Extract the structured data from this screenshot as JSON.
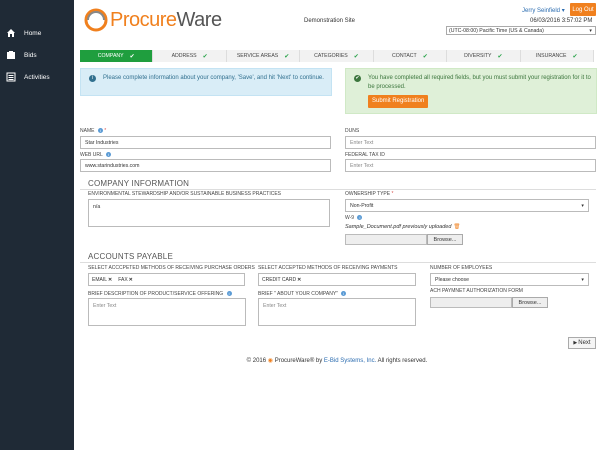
{
  "sidebar": {
    "items": [
      {
        "label": "Home",
        "icon": "home-icon"
      },
      {
        "label": "Bids",
        "icon": "bids-icon"
      },
      {
        "label": "Activities",
        "icon": "activities-icon"
      }
    ]
  },
  "header": {
    "logo_prefix": "Procure",
    "logo_suffix": "Ware",
    "site_title": "Demonstration Site",
    "user_name": "Jerry Seinfield",
    "logout_label": "Log Out",
    "datetime": "06/03/2016 3:57:02 PM",
    "timezone": "(UTC-08:00) Pacific Time (US & Canada)"
  },
  "tabs": [
    {
      "label": "COMPANY",
      "active": true
    },
    {
      "label": "ADDRESS",
      "active": false
    },
    {
      "label": "SERVICE AREAS",
      "active": false
    },
    {
      "label": "CATEGORIES",
      "active": false
    },
    {
      "label": "CONTACT",
      "active": false
    },
    {
      "label": "DIVERSITY",
      "active": false
    },
    {
      "label": "INSURANCE",
      "active": false
    }
  ],
  "alerts": {
    "info": "Please complete information about your company, 'Save', and hit 'Next' to continue.",
    "success": "You have completed all required fields, but you must submit your registration for it to be processed.",
    "submit_label": "Submit Registration"
  },
  "form": {
    "name_label": "NAME",
    "name_value": "Star Industries",
    "duns_label": "DUNS",
    "duns_placeholder": "Enter Text",
    "web_label": "WEB URL",
    "web_value": "www.starindustries.com",
    "tax_label": "FEDERAL TAX ID",
    "tax_placeholder": "Enter Text"
  },
  "company_info": {
    "heading": "COMPANY INFORMATION",
    "env_label": "ENVIRONMENTAL STEWARDSHIP AND/OR SUSTAINABLE BUSINESS PRACTICES",
    "env_value": "n/a",
    "ownership_label": "OWNERSHIP TYPE",
    "ownership_value": "Non-Profit",
    "w9_label": "W-9",
    "w9_file": "Sample_Document.pdf previously uploaded",
    "browse_label": "Browse..."
  },
  "accounts": {
    "heading": "ACCOUNTS PAYABLE",
    "po_label": "SELECT ACCCPETED METHODS OF RECEIVING PURCHASE ORDERS",
    "po_tags": [
      "EMAIL",
      "FAX"
    ],
    "pay_label": "SELECT ACCEPTED METHODS OF RECEIVING PAYMENTS",
    "pay_tags": [
      "CREDIT CARD"
    ],
    "employees_label": "NUMBER OF EMPLOYEES",
    "employees_value": "Please choose",
    "brief_product_label": "BRIEF DESCRIPTION OF PRODUCT/SERVICE OFFERING",
    "brief_product_placeholder": "Enter Text",
    "brief_about_label": "BRIEF \" ABOUT YOUR COMPANY\"",
    "brief_about_placeholder": "Enter Text",
    "ach_label": "ACH PAYMNET AUTHORIZATION FORM",
    "browse_label": "Browse..."
  },
  "next_label": "Next",
  "footer": {
    "prefix": "© 2016",
    "product": "ProcureWare® by",
    "link": "E-Bid Systems, Inc.",
    "suffix": "All rights reserved."
  },
  "colors": {
    "accent": "#f0801e",
    "tab_active": "#1f9e3e",
    "sidebar": "#1f2a36"
  }
}
